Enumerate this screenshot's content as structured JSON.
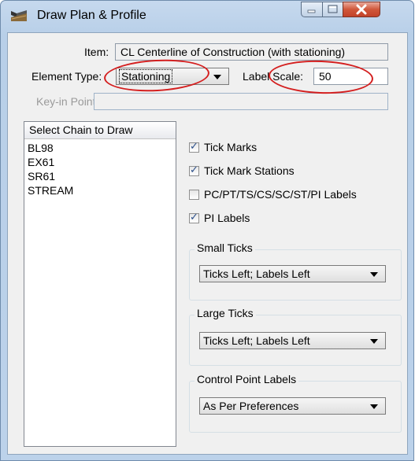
{
  "window": {
    "title": "Draw Plan & Profile"
  },
  "item": {
    "label": "Item:",
    "value": "CL Centerline of Construction (with stationing)"
  },
  "element_type": {
    "label": "Element Type:",
    "value": "Stationing"
  },
  "label_scale": {
    "label": "Label Scale:",
    "value": "50"
  },
  "keyin_points": {
    "label": "Key-in Points:",
    "value": ""
  },
  "chain_list": {
    "header": "Select Chain to Draw",
    "items": [
      "BL98",
      "EX61",
      "SR61",
      "STREAM"
    ]
  },
  "checkboxes": [
    {
      "label": "Tick Marks",
      "checked": true
    },
    {
      "label": "Tick Mark Stations",
      "checked": true
    },
    {
      "label": "PC/PT/TS/CS/SC/ST/PI Labels",
      "checked": false
    },
    {
      "label": "PI Labels",
      "checked": true
    }
  ],
  "small_ticks": {
    "title": "Small Ticks",
    "value": "Ticks Left; Labels Left"
  },
  "large_ticks": {
    "title": "Large Ticks",
    "value": "Ticks Left; Labels Left"
  },
  "control_point_labels": {
    "title": "Control Point Labels",
    "value": "As Per Preferences"
  },
  "colors": {
    "highlight_ellipse": "#d41f1f",
    "close_button": "#c94a30",
    "frame": "#b9d0e9"
  }
}
